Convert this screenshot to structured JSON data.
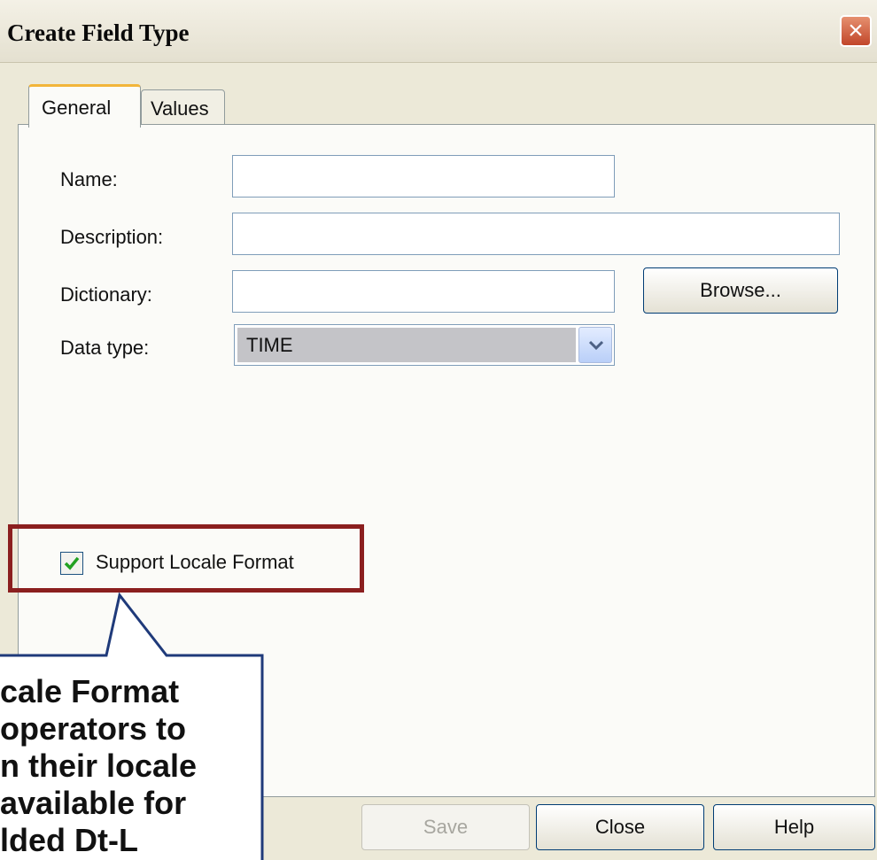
{
  "dialog": {
    "title": "Create Field Type",
    "close_icon": "×"
  },
  "tabs": [
    {
      "label": "General",
      "active": true
    },
    {
      "label": "Values",
      "active": false
    }
  ],
  "form": {
    "name_label": "Name:",
    "name_value": "",
    "description_label": "Description:",
    "description_value": "",
    "dictionary_label": "Dictionary:",
    "dictionary_value": "",
    "browse_label": "Browse...",
    "data_type_label": "Data type:",
    "data_type_value": "TIME",
    "support_locale_label": "Support Locale Format",
    "support_locale_checked": true
  },
  "buttons": {
    "save": "Save",
    "close": "Close",
    "help": "Help"
  },
  "callout": {
    "lines": [
      "cale Format",
      "operators to",
      "n their locale",
      "available for",
      "lded Dt-L"
    ]
  },
  "colors": {
    "highlight_border": "#8b1f1f",
    "callout_border": "#1f3a7a",
    "tab_accent": "#f2b53a",
    "close_button": "#c1462a"
  }
}
